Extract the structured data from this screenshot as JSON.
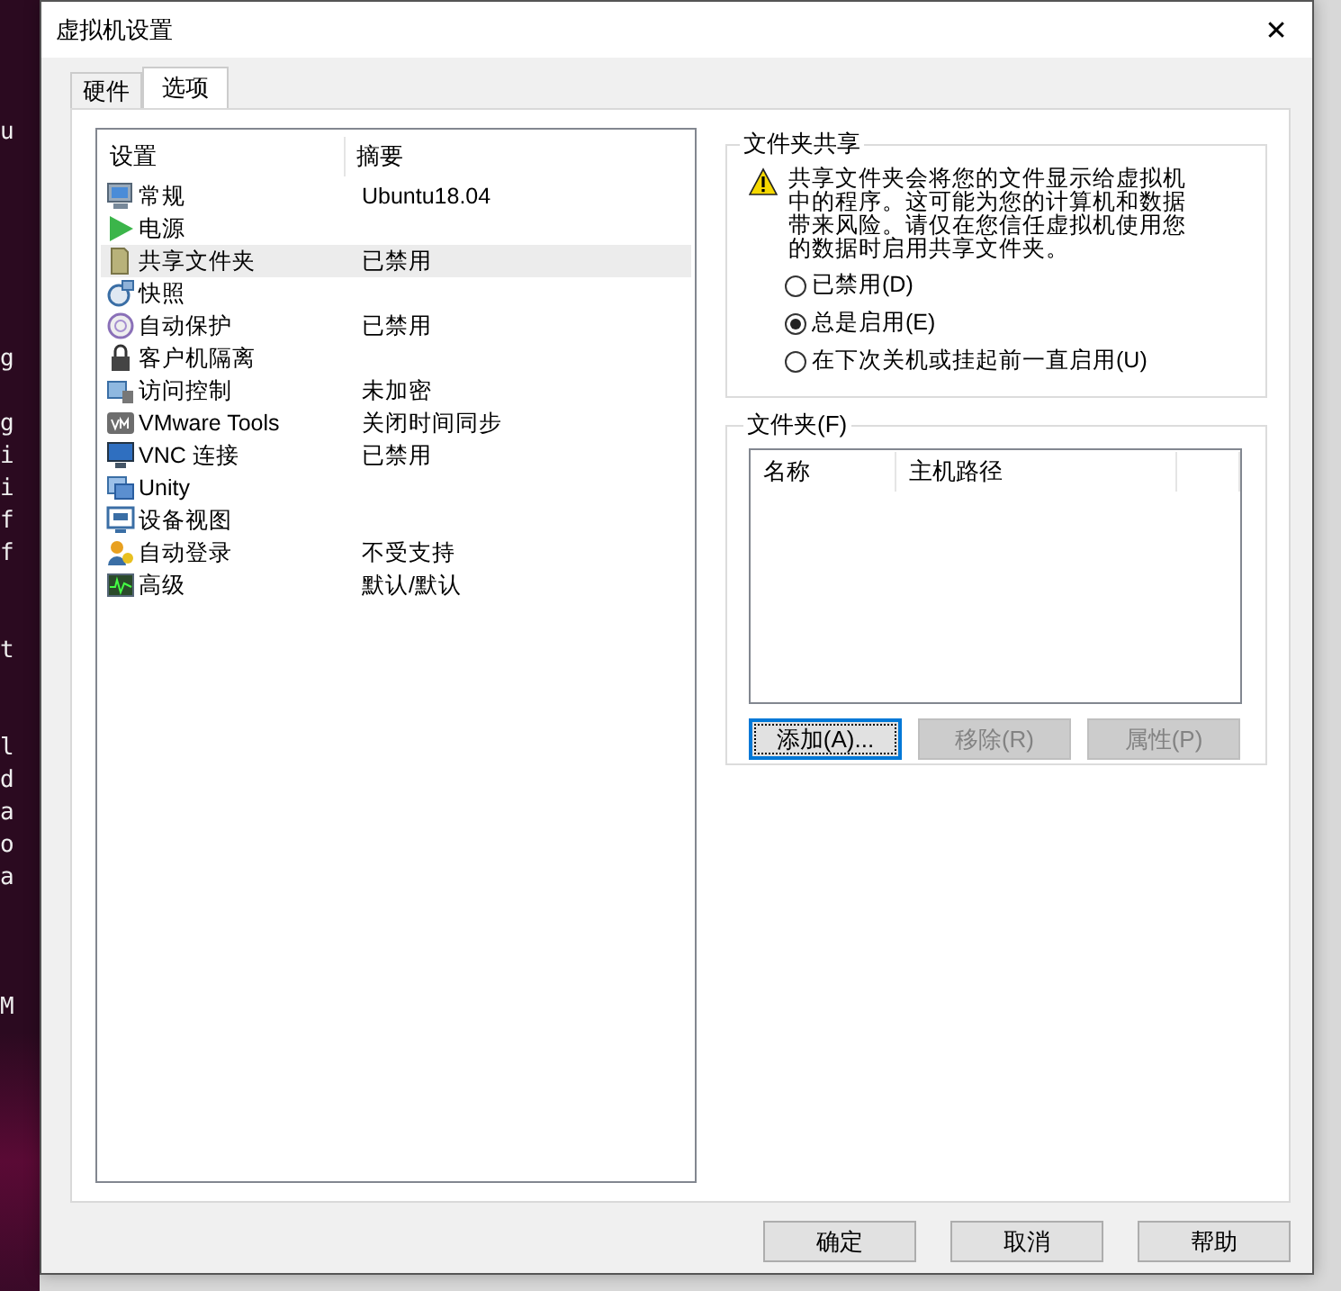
{
  "background_terminal": {
    "lines": [
      "u",
      "g",
      "g",
      "i",
      "i",
      "f",
      "f",
      "t",
      "l",
      "d",
      "a",
      "o",
      "a",
      "M"
    ]
  },
  "window": {
    "title": "虚拟机设置",
    "close": "✕"
  },
  "tabs": [
    {
      "label": "硬件",
      "selected": false
    },
    {
      "label": "选项",
      "selected": true
    }
  ],
  "settings_list": {
    "columns": [
      "设置",
      "摘要"
    ],
    "rows": [
      {
        "setting": "常规",
        "summary": "Ubuntu18.04",
        "selected": false
      },
      {
        "setting": "电源",
        "selected": false
      },
      {
        "setting": "共享文件夹",
        "summary": "已禁用",
        "selected": true
      },
      {
        "setting": "快照",
        "selected": false
      },
      {
        "setting": "自动保护",
        "summary": "已禁用",
        "selected": false
      },
      {
        "setting": "客户机隔离",
        "selected": false
      },
      {
        "setting": "访问控制",
        "summary": "未加密",
        "selected": false
      },
      {
        "setting": "VMware Tools",
        "summary": "关闭时间同步",
        "selected": false
      },
      {
        "setting": "VNC 连接",
        "summary": "已禁用",
        "selected": false
      },
      {
        "setting": "Unity",
        "selected": false
      },
      {
        "setting": "设备视图",
        "selected": false
      },
      {
        "setting": "自动登录",
        "summary": "不受支持",
        "selected": false
      },
      {
        "setting": "高级",
        "summary": "默认/默认",
        "selected": false
      }
    ]
  },
  "folder_sharing": {
    "title": "文件夹共享",
    "warning": "共享文件夹会将您的文件显示给虚拟机中的程序。这可能为您的计算机和数据带来风险。请仅在您信任虚拟机使用您的数据时启用共享文件夹。",
    "options": [
      {
        "label": "已禁用(D)",
        "selected": false
      },
      {
        "label": "总是启用(E)",
        "selected": true
      },
      {
        "label": "在下次关机或挂起前一直启用(U)",
        "selected": false
      }
    ]
  },
  "folders": {
    "title": "文件夹(F)",
    "columns": [
      "名称",
      "主机路径"
    ],
    "buttons": [
      {
        "label": "添加(A)...",
        "disabled": false,
        "focused": true
      },
      {
        "label": "移除(R)",
        "disabled": true,
        "focused": false
      },
      {
        "label": "属性(P)",
        "disabled": true,
        "focused": false
      }
    ]
  },
  "footer_buttons": [
    "确定",
    "取消",
    "帮助"
  ]
}
